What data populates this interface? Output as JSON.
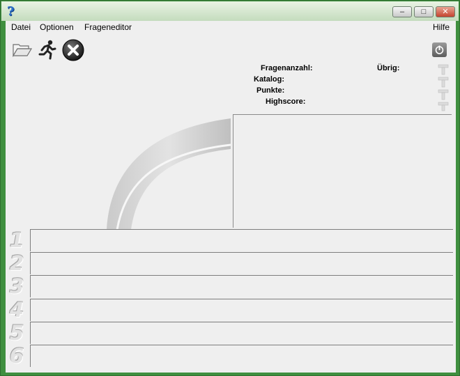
{
  "window": {
    "icon": "question-mark-app-icon",
    "controls": {
      "minimize": "–",
      "maximize": "□",
      "close": "✕"
    }
  },
  "menu": {
    "datei": "Datei",
    "optionen": "Optionen",
    "frageneditor": "Frageneditor",
    "hilfe": "Hilfe"
  },
  "toolbar": {
    "icons": [
      "folder-open-icon",
      "runner-start-icon",
      "close-circle-icon",
      "power-icon"
    ]
  },
  "info": {
    "fragenanzahl": "Fragenanzahl:",
    "uebrig": "Übrig:",
    "katalog": "Katalog:",
    "punkte": "Punkte:",
    "highscore": "Highscore:"
  },
  "answers": {
    "numbers": [
      "1",
      "2",
      "3",
      "4",
      "5",
      "6"
    ]
  },
  "colors": {
    "frame": "#3f8f3f",
    "client_bg": "#efefef",
    "field_border": "#7d7d7d"
  }
}
